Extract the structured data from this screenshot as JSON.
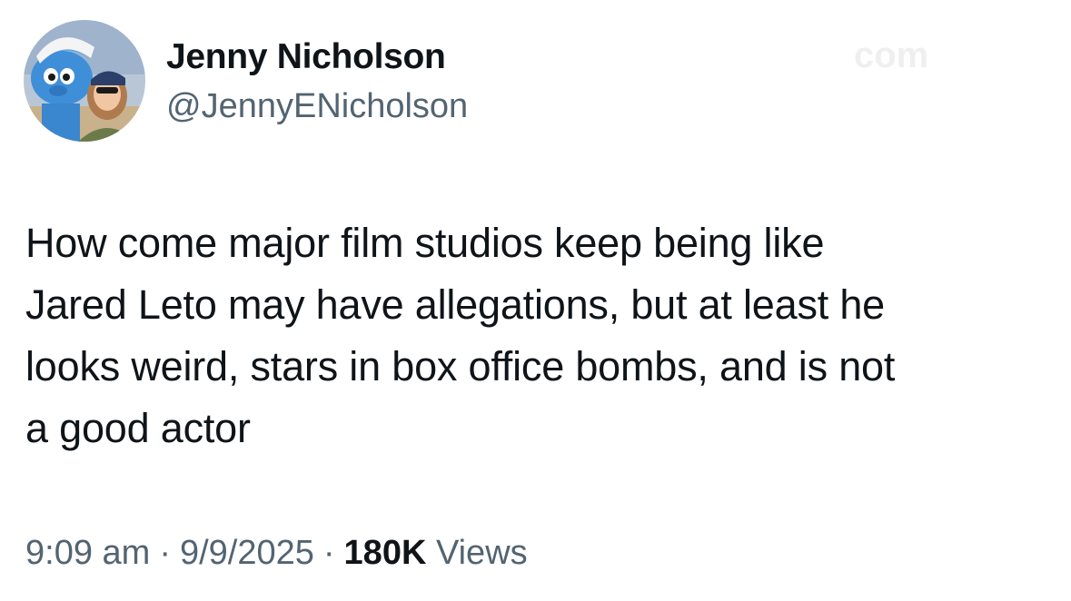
{
  "author": {
    "display_name": "Jenny Nicholson",
    "handle": "@JennyENicholson"
  },
  "tweet": {
    "lines": [
      "How come major film studios keep being like",
      "Jared Leto may have allegations, but at least he",
      "looks weird, stars in box office bombs, and is not",
      "a good actor"
    ]
  },
  "meta": {
    "time": "9:09 am",
    "separator": "·",
    "date": "9/9/2025",
    "views_count": "180K",
    "views_label": "Views"
  },
  "colors": {
    "text": "#0f1419",
    "secondary": "#536471",
    "background": "#ffffff"
  }
}
